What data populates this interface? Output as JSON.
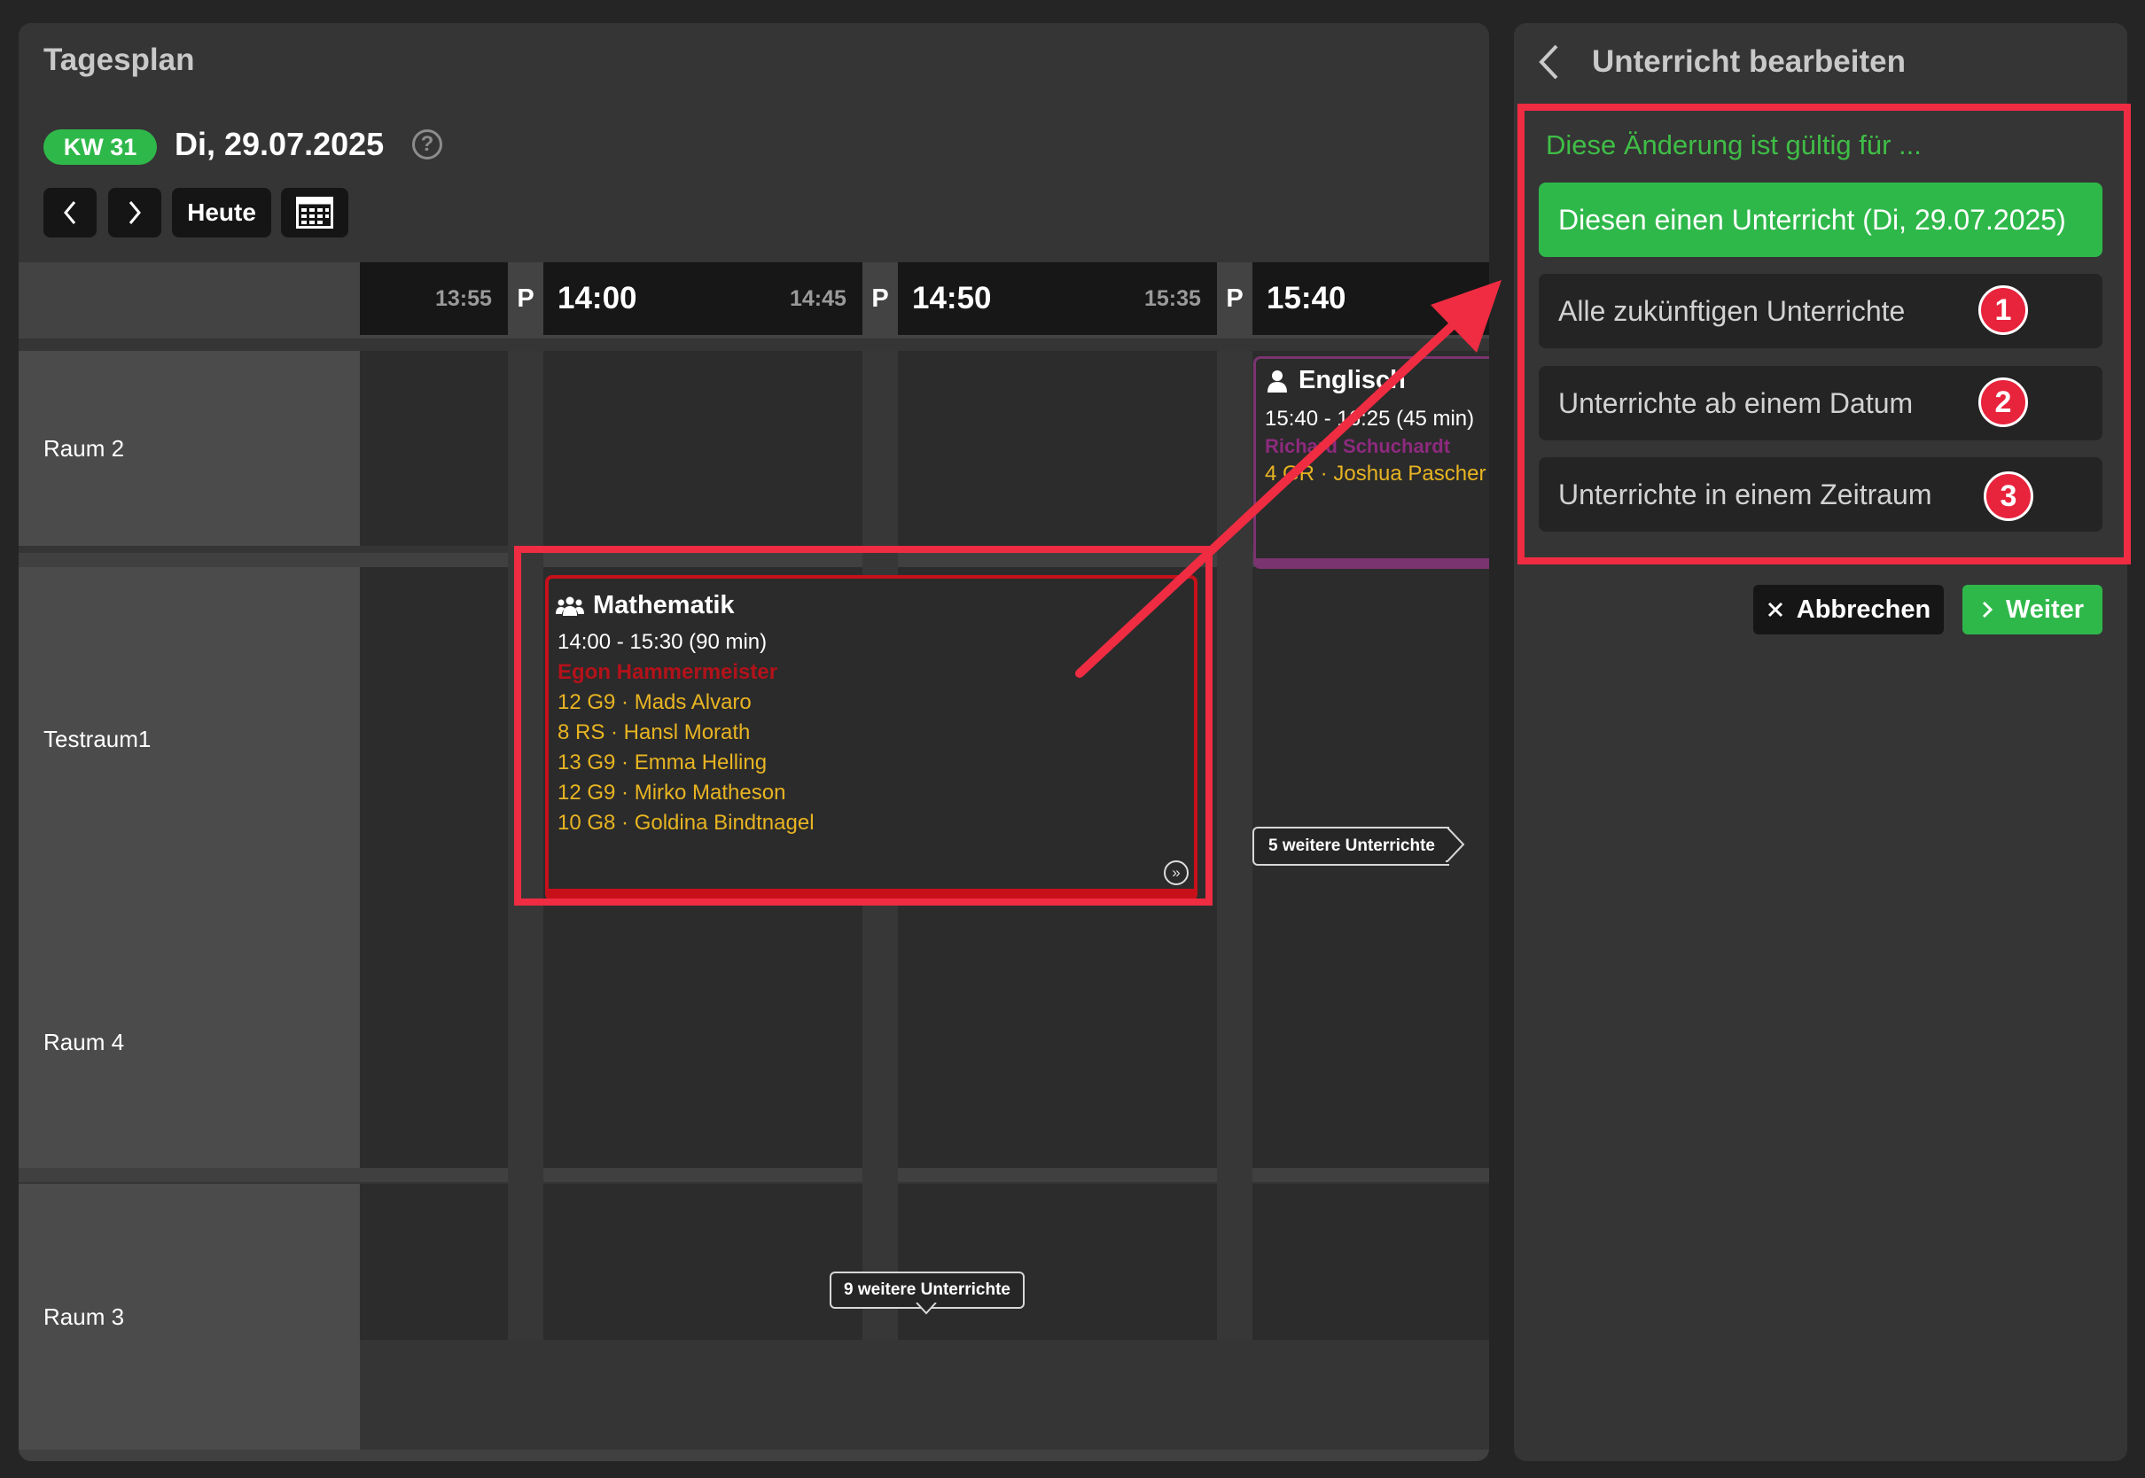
{
  "left_panel": {
    "title": "Tagesplan",
    "week_badge": "KW 31",
    "date": "Di, 29.07.2025",
    "help_glyph": "?",
    "today_label": "Heute"
  },
  "timeline": {
    "slots": [
      {
        "end": "13:55",
        "pause": "P",
        "start": "14:00"
      },
      {
        "end": "14:45",
        "pause": "P",
        "start": "14:50"
      },
      {
        "end": "15:35",
        "pause": "P",
        "start": "15:40"
      }
    ]
  },
  "rooms": [
    "Raum 2",
    "Testraum1",
    "Raum 4",
    "Raum 3"
  ],
  "lessons": {
    "math": {
      "title": "Mathematik",
      "time": "14:00 - 15:30  (90 min)",
      "teacher": "Egon Hammermeister",
      "classes": [
        "12 G9 · Mads Alvaro",
        "8 RS · Hansl Morath",
        "13 G9 · Emma Helling",
        "12 G9 · Mirko Matheson",
        "10 G8 · Goldina Bindtnagel"
      ],
      "icon": "group-icon",
      "color": "#c8101a"
    },
    "english": {
      "title": "Englisch",
      "time": "15:40 - 16:25  (45 min)",
      "teacher": "Richard Schuchardt",
      "class": "4 GR · Joshua Pascher",
      "icon": "person-icon",
      "color": "#8d2a7e"
    }
  },
  "more_tags": {
    "testraum": "5 weitere Unterrichte",
    "raum3": "9 weitere Unterrichte"
  },
  "right_panel": {
    "title": "Unterricht bearbeiten",
    "subtitle": "Diese Änderung ist gültig für ...",
    "options": [
      "Diesen einen Unterricht (Di, 29.07.2025)",
      "Alle zukünftigen Unterrichte",
      "Unterrichte ab einem Datum",
      "Unterrichte in einem Zeitraum"
    ],
    "badges": [
      "1",
      "2",
      "3"
    ],
    "cancel_label": "Abbrechen",
    "next_label": "Weiter"
  },
  "colors": {
    "accent_green": "#2fb84a",
    "annotation_red": "#ef2c42",
    "class_yellow": "#e8b422"
  }
}
